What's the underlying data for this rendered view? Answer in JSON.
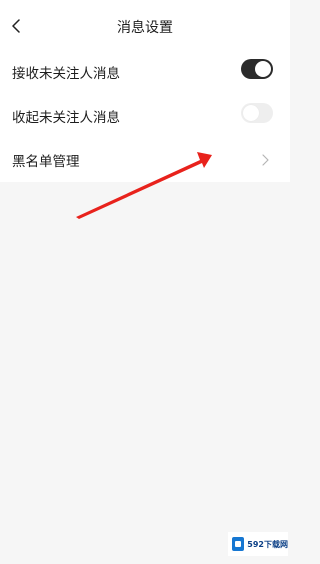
{
  "header": {
    "title": "消息设置",
    "back_icon": "chevron-left-icon"
  },
  "settings": {
    "items": [
      {
        "label": "接收未关注人消息",
        "control": "toggle",
        "enabled": true
      },
      {
        "label": "收起未关注人消息",
        "control": "toggle",
        "enabled": false
      },
      {
        "label": "黑名单管理",
        "control": "chevron",
        "icon": "chevron-right-icon"
      }
    ]
  },
  "annotation": {
    "color": "#e8221c",
    "icon": "red-arrow"
  },
  "watermark": {
    "text": "592下载网"
  },
  "colors": {
    "toggle_on": "#2b2b2b",
    "toggle_off": "#eeeeee",
    "background": "#f6f6f6"
  }
}
